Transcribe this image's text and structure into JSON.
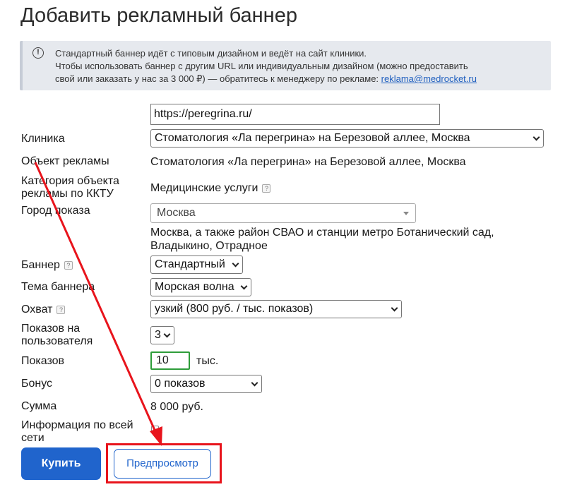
{
  "page": {
    "title": "Добавить рекламный баннер"
  },
  "notice": {
    "line1": "Стандартный баннер идёт с типовым дизайном и ведёт на сайт клиники.",
    "line2": "Чтобы использовать баннер с другим URL или индивидуальным дизайном (можно предоставить",
    "line3_prefix": "свой или заказать у нас за 3 000 ₽) — обратитесь к менеджеру по рекламе: ",
    "email": "reklama@medrocket.ru",
    "icon": "info-icon"
  },
  "form": {
    "url_value": "https://peregrina.ru/",
    "clinic_label": "Клиника",
    "clinic_value": "Стоматология «Ла перегрина» на Березовой аллее, Москва",
    "object_label": "Объект рекламы",
    "object_value": "Стоматология «Ла перегрина» на Березовой аллее, Москва",
    "category_label_1": "Категория объекта",
    "category_label_2": "рекламы по ККТУ",
    "category_value": "Медицинские услуги",
    "city_label": "Город показа",
    "city_value": "Москва",
    "city_note_1": "Москва, а также район СВАО и станции метро Ботанический сад,",
    "city_note_2": "Владыкино, Отрадное",
    "banner_label": "Баннер",
    "banner_value": "Стандартный",
    "theme_label": "Тема баннера",
    "theme_value": "Морская волна",
    "reach_label": "Охват",
    "reach_value": "узкий (800 руб. / тыс. показов)",
    "per_user_label_1": "Показов на",
    "per_user_label_2": "пользователя",
    "per_user_value": "3",
    "shows_label": "Показов",
    "shows_value": "10",
    "shows_unit": "тыс.",
    "bonus_label": "Бонус",
    "bonus_value": "0 показов",
    "sum_label": "Сумма",
    "sum_value": "8 000 руб.",
    "network_label_1": "Информация по всей",
    "network_label_2": "сети",
    "help_glyph": "?"
  },
  "actions": {
    "buy_label": "Купить",
    "preview_label": "Предпросмотр"
  },
  "colors": {
    "primary": "#2064cc",
    "annotation": "#e8141c",
    "valid": "#2e9d3a"
  }
}
